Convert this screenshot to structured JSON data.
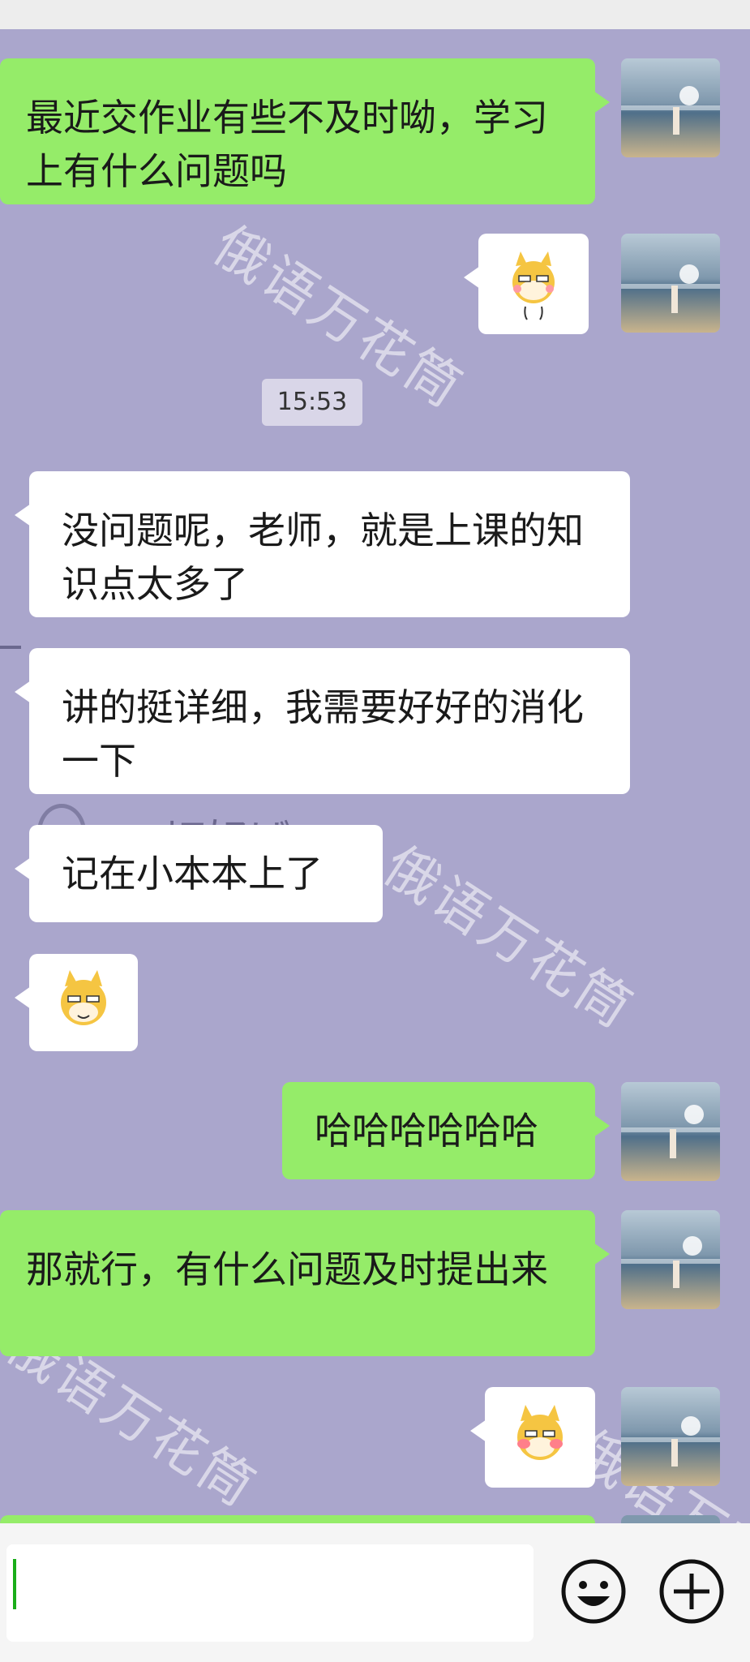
{
  "watermark_text": "俄语万花筒",
  "timestamp": "15:53",
  "messages": {
    "m1": "最近交作业有些不及时呦，学习上有什么问题吗",
    "m2": "没问题呢，老师，就是上课的知识点太多了",
    "m3": "讲的挺详细，我需要好好的消化一下",
    "m4": "记在小本本上了",
    "m5": "哈哈哈哈哈哈",
    "m6": "那就行，有什么问题及时提出来"
  },
  "stickers": [
    "doge-sticker",
    "doge-sticker",
    "doge-blush-sticker"
  ],
  "background_doodle": "一切好ば",
  "colors": {
    "chat_bg": "#aaa6cc",
    "my_bubble": "#95ec69",
    "their_bubble": "#ffffff",
    "cursor": "#1aad19"
  },
  "input": {
    "value": ""
  }
}
